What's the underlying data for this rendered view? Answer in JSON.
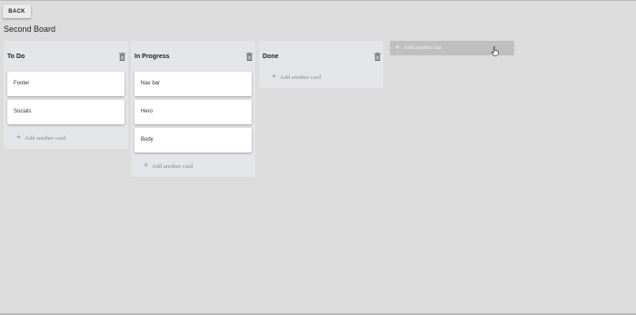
{
  "back_label": "BACK",
  "board_title": "Second Board",
  "lists": [
    {
      "title": "To Do",
      "cards": [
        "Footer",
        "Socials"
      ],
      "add_card_label": "Add another card"
    },
    {
      "title": "In Progress",
      "cards": [
        "Nav bar",
        "Hero",
        "Body"
      ],
      "add_card_label": "Add another card"
    },
    {
      "title": "Done",
      "cards": [],
      "add_card_label": "Add another card"
    }
  ],
  "add_list_label": "Add another list",
  "icons": {
    "delete": "trash-icon",
    "add": "plus-icon",
    "cursor": "hand-pointer-icon"
  },
  "colors": {
    "background": "#dcdcdc",
    "list": "#e3e5e8",
    "card": "#ffffff",
    "add_list": "#bfbfbf"
  }
}
